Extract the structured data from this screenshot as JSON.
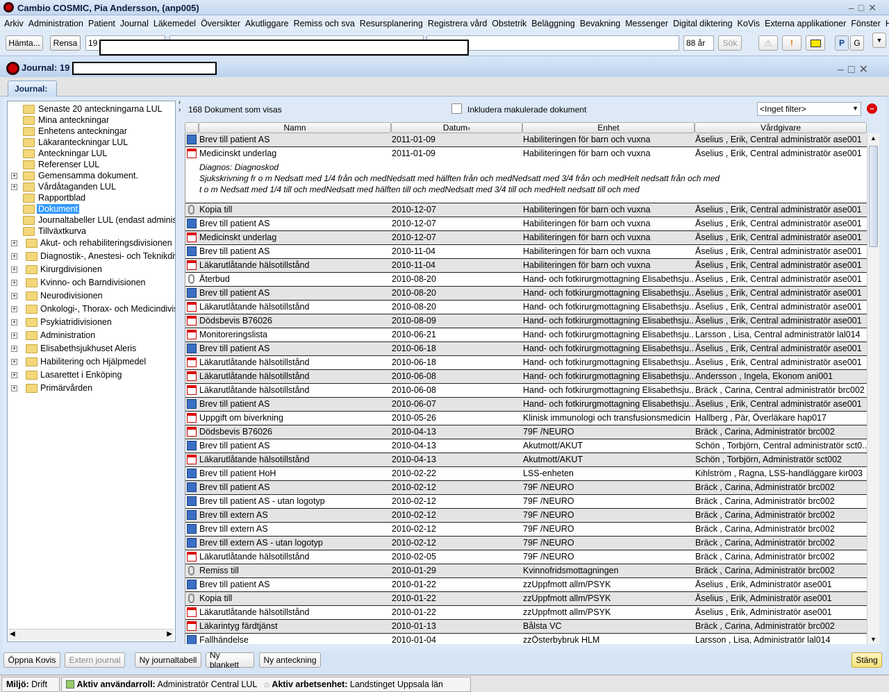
{
  "app": {
    "title": "Cambio COSMIC, Pia Andersson, (anp005)"
  },
  "menu": [
    "Arkiv",
    "Administration",
    "Patient",
    "Journal",
    "Läkemedel",
    "Översikter",
    "Akutliggare",
    "Remiss och sva",
    "Resursplanering",
    "Registrera vård",
    "Obstetrik",
    "Beläggning",
    "Bevakning",
    "Messenger",
    "Digital diktering",
    "KoVis",
    "Externa applikationer",
    "Fönster",
    "Hjälp"
  ],
  "toolbar": {
    "fetch": "Hämta...",
    "clear": "Rensa",
    "patient_id": "19",
    "age": "88 år",
    "search": "Sök",
    "p": "P",
    "g": "G"
  },
  "journal": {
    "title": "Journal: 19",
    "tab": "Journal:"
  },
  "tree": [
    {
      "label": "Senaste 20 anteckningarna LUL"
    },
    {
      "label": "Mina anteckningar"
    },
    {
      "label": "Enhetens anteckningar"
    },
    {
      "label": "Läkaranteckningar LUL"
    },
    {
      "label": "Anteckningar LUL"
    },
    {
      "label": "Referenser LUL"
    },
    {
      "label": "Gemensamma dokument.",
      "expandable": true
    },
    {
      "label": "Vårdåtaganden LUL",
      "expandable": true
    },
    {
      "label": "Rapportblad"
    },
    {
      "label": "Dokument",
      "selected": true
    },
    {
      "label": "Journaltabeller LUL (endast administratör)"
    },
    {
      "label": "Tillväxtkurva"
    }
  ],
  "tree_divisions": [
    "Akut- och rehabiliteringsdivisionen",
    "Diagnostik-, Anestesi- och Teknikdivisionen",
    "Kirurgdivisionen",
    "Kvinno- och Barndivisionen",
    "Neurodivisionen",
    "Onkologi-, Thorax- och Medicindivisionen",
    "Psykiatridivisionen",
    "Administration",
    "Elisabethsjukhuset Aleris",
    "Habilitering och Hjälpmedel",
    "Lasarettet i Enköping",
    "Primärvården"
  ],
  "docs": {
    "count_label": "168 Dokument som visas",
    "include_voided": "Inkludera makulerade dokument",
    "include_voided_checked": false,
    "filter": "<Inget filter>",
    "columns": [
      "Namn",
      "Datum",
      "Enhet",
      "Vårdgivare"
    ],
    "detail": [
      "Diagnos: Diagnoskod",
      "Sjukskrivning fr o m Nedsatt med 1/4 från och medNedsatt med hälften från och medNedsatt med 3/4 från och medHelt nedsatt från och med",
      "t o m Nedsatt med 1/4 till och medNedsatt med hälften till och medNedsatt med 3/4 till och medHelt nedsatt till och med"
    ],
    "rows": [
      [
        "word",
        "Brev till patient AS",
        "2011-01-09",
        "Habiliteringen för barn och vuxna",
        "Åselius , Erik, Central administratör ase001"
      ],
      [
        "pdf",
        "Medicinskt underlag",
        "2011-01-09",
        "Habiliteringen för barn och vuxna",
        "Åselius , Erik, Central administratör ase001"
      ],
      [
        "clip",
        "Kopia till",
        "2010-12-07",
        "Habiliteringen för barn och vuxna",
        "Åselius , Erik, Central administratör ase001"
      ],
      [
        "word",
        "Brev till patient AS",
        "2010-12-07",
        "Habiliteringen för barn och vuxna",
        "Åselius , Erik, Central administratör ase001"
      ],
      [
        "pdf",
        "Medicinskt underlag",
        "2010-12-07",
        "Habiliteringen för barn och vuxna",
        "Åselius , Erik, Central administratör ase001"
      ],
      [
        "word",
        "Brev till patient AS",
        "2010-11-04",
        "Habiliteringen för barn och vuxna",
        "Åselius , Erik, Central administratör ase001"
      ],
      [
        "pdf",
        "Läkarutlåtande hälsotillstånd",
        "2010-11-04",
        "Habiliteringen för barn och vuxna",
        "Åselius , Erik, Central administratör ase001"
      ],
      [
        "clip",
        "Återbud",
        "2010-08-20",
        "Hand- och fotkirurgmottagning Elisabethsju...",
        "Åselius , Erik, Central administratör ase001"
      ],
      [
        "word",
        "Brev till patient AS",
        "2010-08-20",
        "Hand- och fotkirurgmottagning Elisabethsju...",
        "Åselius , Erik, Central administratör ase001"
      ],
      [
        "pdf",
        "Läkarutlåtande hälsotillstånd",
        "2010-08-20",
        "Hand- och fotkirurgmottagning Elisabethsju...",
        "Åselius , Erik, Central administratör ase001"
      ],
      [
        "pdf",
        "Dödsbevis B76026",
        "2010-08-09",
        "Hand- och fotkirurgmottagning Elisabethsju...",
        "Åselius , Erik, Central administratör ase001"
      ],
      [
        "pdf",
        "Monitoreringslista",
        "2010-06-21",
        "Hand- och fotkirurgmottagning Elisabethsju...",
        "Larsson , Lisa, Central administratör lal014"
      ],
      [
        "word",
        "Brev till patient AS",
        "2010-06-18",
        "Hand- och fotkirurgmottagning Elisabethsju...",
        "Åselius , Erik, Central administratör ase001"
      ],
      [
        "pdf",
        "Läkarutlåtande hälsotillstånd",
        "2010-06-18",
        "Hand- och fotkirurgmottagning Elisabethsju...",
        "Åselius , Erik, Central administratör ase001"
      ],
      [
        "pdf",
        "Läkarutlåtande hälsotillstånd",
        "2010-06-08",
        "Hand- och fotkirurgmottagning Elisabethsju...",
        "Andersson , Ingela, Ekonom ani001"
      ],
      [
        "pdf",
        "Läkarutlåtande hälsotillstånd",
        "2010-06-08",
        "Hand- och fotkirurgmottagning Elisabethsju...",
        "Bräck , Carina, Central administratör brc002"
      ],
      [
        "word",
        "Brev till patient AS",
        "2010-06-07",
        "Hand- och fotkirurgmottagning Elisabethsju...",
        "Åselius , Erik, Central administratör ase001"
      ],
      [
        "pdf",
        "Uppgift om biverkning",
        "2010-05-26",
        "Klinisk immunologi och transfusionsmedicin",
        "Hallberg , Pär, Överläkare hap017"
      ],
      [
        "pdf",
        "Dödsbevis B76026",
        "2010-04-13",
        "79F /NEURO",
        "Bräck , Carina, Administratör brc002"
      ],
      [
        "word",
        "Brev till patient AS",
        "2010-04-13",
        "Akutmott/AKUT",
        "Schön , Torbjörn, Central administratör sct0..."
      ],
      [
        "pdf",
        "Läkarutlåtande hälsotillstånd",
        "2010-04-13",
        "Akutmott/AKUT",
        "Schön , Torbjörn, Administratör sct002"
      ],
      [
        "word",
        "Brev till patient HoH",
        "2010-02-22",
        "LSS-enheten",
        "Kihlström , Ragna, LSS-handläggare kir003"
      ],
      [
        "word",
        "Brev till patient AS",
        "2010-02-12",
        "79F /NEURO",
        "Bräck , Carina, Administratör brc002"
      ],
      [
        "word",
        "Brev till patient AS - utan logotyp",
        "2010-02-12",
        "79F /NEURO",
        "Bräck , Carina, Administratör brc002"
      ],
      [
        "word",
        "Brev till extern AS",
        "2010-02-12",
        "79F /NEURO",
        "Bräck , Carina, Administratör brc002"
      ],
      [
        "word",
        "Brev till extern AS",
        "2010-02-12",
        "79F /NEURO",
        "Bräck , Carina, Administratör brc002"
      ],
      [
        "word",
        "Brev till extern AS - utan logotyp",
        "2010-02-12",
        "79F /NEURO",
        "Bräck , Carina, Administratör brc002"
      ],
      [
        "pdf",
        "Läkarutlåtande hälsotillstånd",
        "2010-02-05",
        "79F /NEURO",
        "Bräck , Carina, Administratör brc002"
      ],
      [
        "clip",
        "Remiss till",
        "2010-01-29",
        "Kvinnofridsmottagningen",
        "Bräck , Carina, Administratör brc002"
      ],
      [
        "word",
        "Brev till patient AS",
        "2010-01-22",
        "zzUppfmott allm/PSYK",
        "Åselius , Erik, Administratör ase001"
      ],
      [
        "clip",
        "Kopia till",
        "2010-01-22",
        "zzUppfmott allm/PSYK",
        "Åselius , Erik, Administratör ase001"
      ],
      [
        "pdf",
        "Läkarutlåtande hälsotillstånd",
        "2010-01-22",
        "zzUppfmott allm/PSYK",
        "Åselius , Erik, Administratör ase001"
      ],
      [
        "pdf",
        "Läkarintyg färdtjänst",
        "2010-01-13",
        "Bålsta VC",
        "Bräck , Carina, Administratör brc002"
      ],
      [
        "word",
        "Fallhändelse",
        "2010-01-04",
        "zzÖsterbybruk HLM",
        "Larsson , Lisa, Administratör lal014"
      ]
    ]
  },
  "buttons": {
    "open_kovis": "Öppna Kovis",
    "external_journal": "Extern journal",
    "new_table": "Ny journaltabell",
    "new_form": "Ny blankett",
    "new_note": "Ny anteckning",
    "close": "Stäng"
  },
  "status": {
    "env_label": "Miljö:",
    "env": "Drift",
    "role_label": "Aktiv användarroll:",
    "role": "Administratör Central LUL",
    "unit_label": "Aktiv arbetsenhet:",
    "unit": "Landstinget Uppsala län"
  }
}
